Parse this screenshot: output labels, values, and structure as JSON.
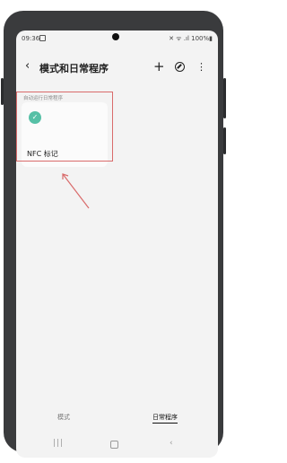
{
  "status_bar": {
    "time": "09:36",
    "right": "✕ ᯤ .ıl 100%▮"
  },
  "app_bar": {
    "title": "模式和日常程序",
    "back_icon": "‹",
    "add_icon": "+",
    "discover_icon": "compass-icon",
    "more_icon": "⋮"
  },
  "section": {
    "label": "自动运行日常程序"
  },
  "routine_card": {
    "label": "NFC 标记",
    "icon": "check-circle-icon"
  },
  "bottom_tabs": {
    "modes": "模式",
    "routines": "日常程序"
  },
  "nav": {
    "recent": "|||",
    "back": "‹"
  },
  "colors": {
    "accent": "#56c0a6",
    "highlight": "#d96b6b"
  }
}
